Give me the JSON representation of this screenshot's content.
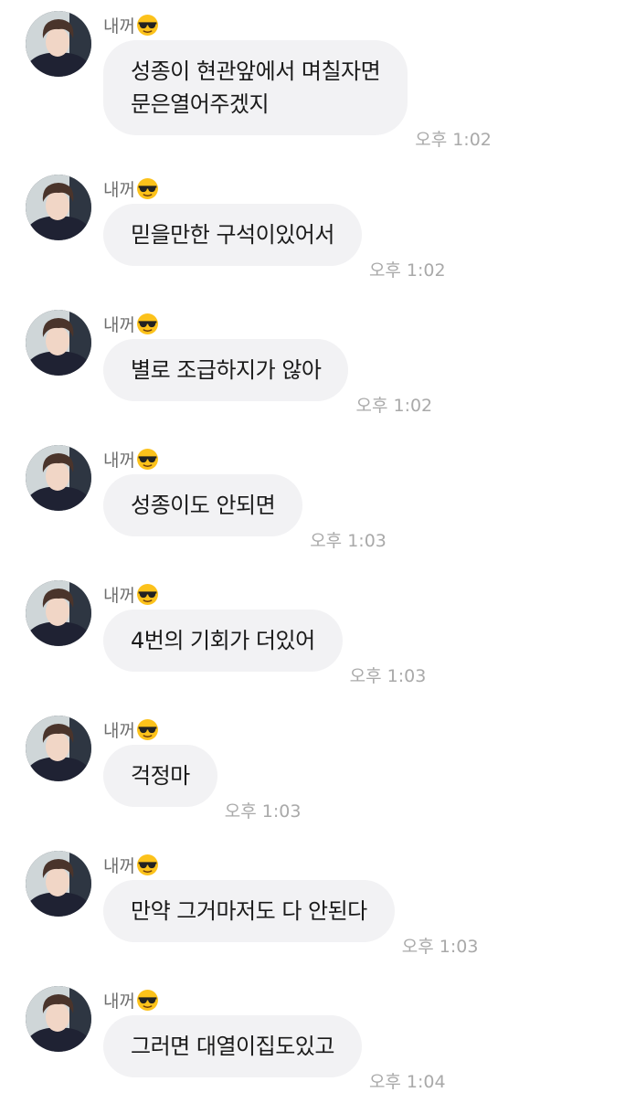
{
  "chat": {
    "sender_name": "내꺼",
    "sender_emoji": "smiling-face-with-sunglasses-icon",
    "messages": [
      {
        "text": "성종이 현관앞에서 며칠자면\n문은열어주겠지",
        "time": "오후 1:02"
      },
      {
        "text": "믿을만한 구석이있어서",
        "time": "오후 1:02"
      },
      {
        "text": "별로 조급하지가 않아",
        "time": "오후 1:02"
      },
      {
        "text": "성종이도 안되면",
        "time": "오후 1:03"
      },
      {
        "text": "4번의 기회가 더있어",
        "time": "오후 1:03"
      },
      {
        "text": "걱정마",
        "time": "오후 1:03"
      },
      {
        "text": "만약 그거마저도 다 안된다",
        "time": "오후 1:03"
      },
      {
        "text": "그러면 대열이집도있고",
        "time": "오후 1:04"
      }
    ]
  },
  "colors": {
    "bubble": "#f2f2f4",
    "sender": "#6f6f6f",
    "time": "#a9a9a9"
  }
}
